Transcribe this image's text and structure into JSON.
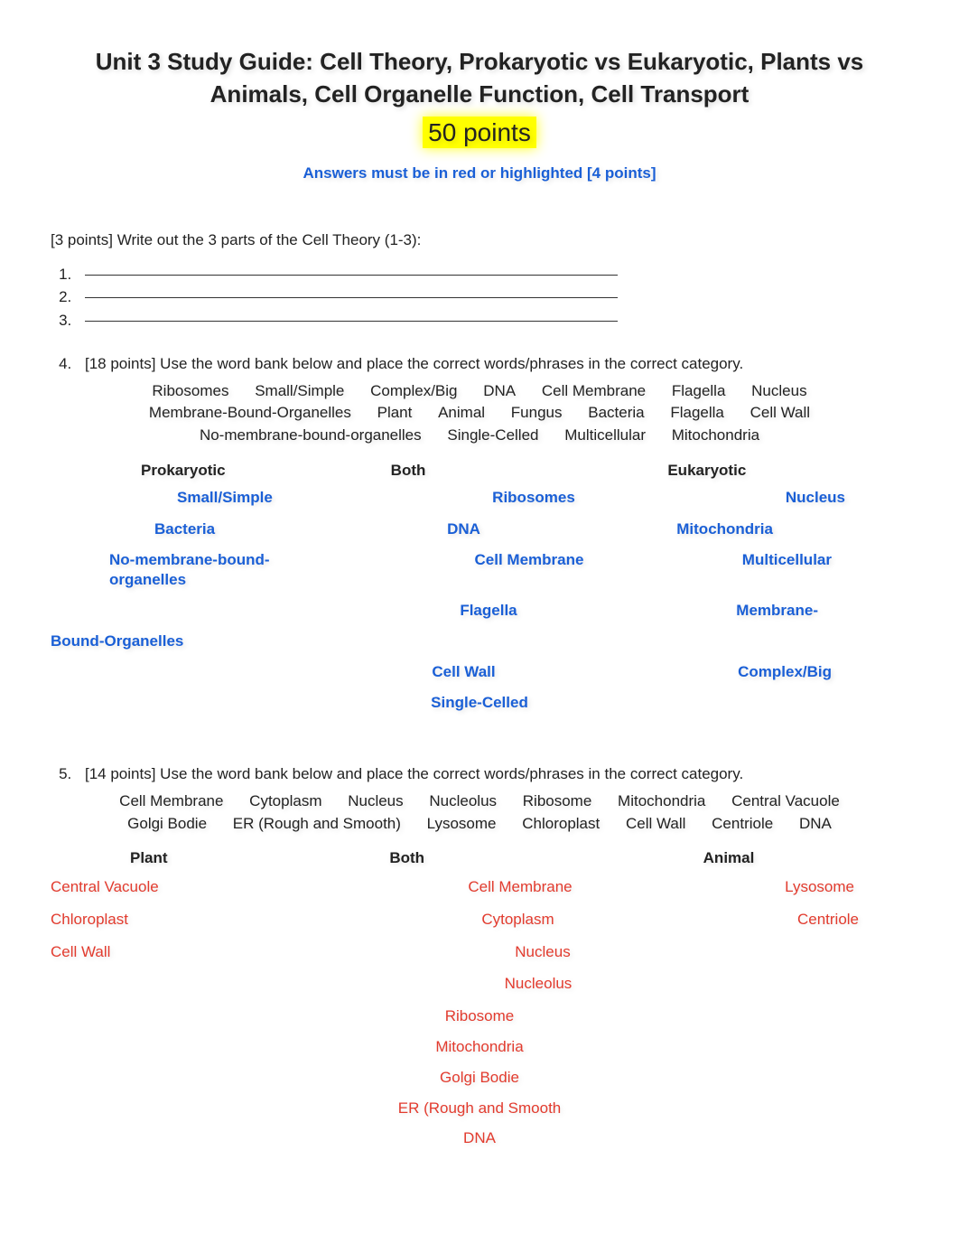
{
  "header": {
    "title": "Unit 3 Study Guide: Cell Theory, Prokaryotic vs Eukaryotic, Plants vs Animals, Cell Organelle Function, Cell Transport",
    "points": "50 points",
    "instruction": "Answers must be in red or highlighted [4 points]"
  },
  "q_cell_theory": {
    "prompt": "[3 points] Write out the 3 parts of the Cell Theory (1-3):"
  },
  "q4": {
    "prompt": "[18 points] Use the word bank below and place the correct words/phrases in the correct category.",
    "wordbank": [
      "Ribosomes",
      "Small/Simple",
      "Complex/Big",
      "DNA",
      "Cell Membrane",
      "Flagella",
      "Nucleus",
      "Membrane-Bound-Organelles",
      "Plant",
      "Animal",
      "Fungus",
      "Bacteria",
      "Flagella",
      "Cell Wall",
      "No-membrane-bound-organelles",
      "Single-Celled",
      "Multicellular",
      "Mitochondria"
    ],
    "headers": {
      "left": "Prokaryotic",
      "mid": "Both",
      "right": "Eukaryotic"
    },
    "rows": [
      {
        "l": "Small/Simple",
        "m": "Ribosomes",
        "r": "Nucleus"
      },
      {
        "l": "Bacteria",
        "m": "DNA",
        "r": "Mitochondria"
      },
      {
        "l": "No-membrane-bound-organelles",
        "m": "Cell Membrane",
        "r": "Multicellular"
      }
    ],
    "flagella_row": {
      "m": "Flagella",
      "r_prefix": "Membrane-",
      "wrap": "Bound-Organelles"
    },
    "rows2": [
      {
        "l": "",
        "m": "Cell Wall",
        "r": "Complex/Big"
      },
      {
        "l": "",
        "m": "Single-Celled",
        "r": ""
      }
    ]
  },
  "q5": {
    "prompt": "[14 points] Use the word bank below and place the correct words/phrases in the correct category.",
    "wordbank": [
      "Cell Membrane",
      "Cytoplasm",
      "Nucleus",
      "Nucleolus",
      "Ribosome",
      "Mitochondria",
      "Central Vacuole",
      "Golgi Bodie",
      "ER (Rough and Smooth)",
      "Lysosome",
      "Chloroplast",
      "Cell Wall",
      "Centriole",
      "DNA"
    ],
    "headers": {
      "left": "Plant",
      "mid": "Both",
      "right": "Animal"
    },
    "rows": [
      {
        "l": "Central Vacuole",
        "m": "Cell Membrane",
        "r": "Lysosome"
      },
      {
        "l": "Chloroplast",
        "m": "Cytoplasm",
        "r": "Centriole"
      },
      {
        "l": "Cell Wall",
        "m": "Nucleus",
        "r": ""
      },
      {
        "l": "",
        "m": "Nucleolus",
        "r": ""
      }
    ],
    "both_only": [
      "Ribosome",
      "Mitochondria",
      "Golgi Bodie",
      "ER (Rough and Smooth",
      "DNA"
    ]
  }
}
